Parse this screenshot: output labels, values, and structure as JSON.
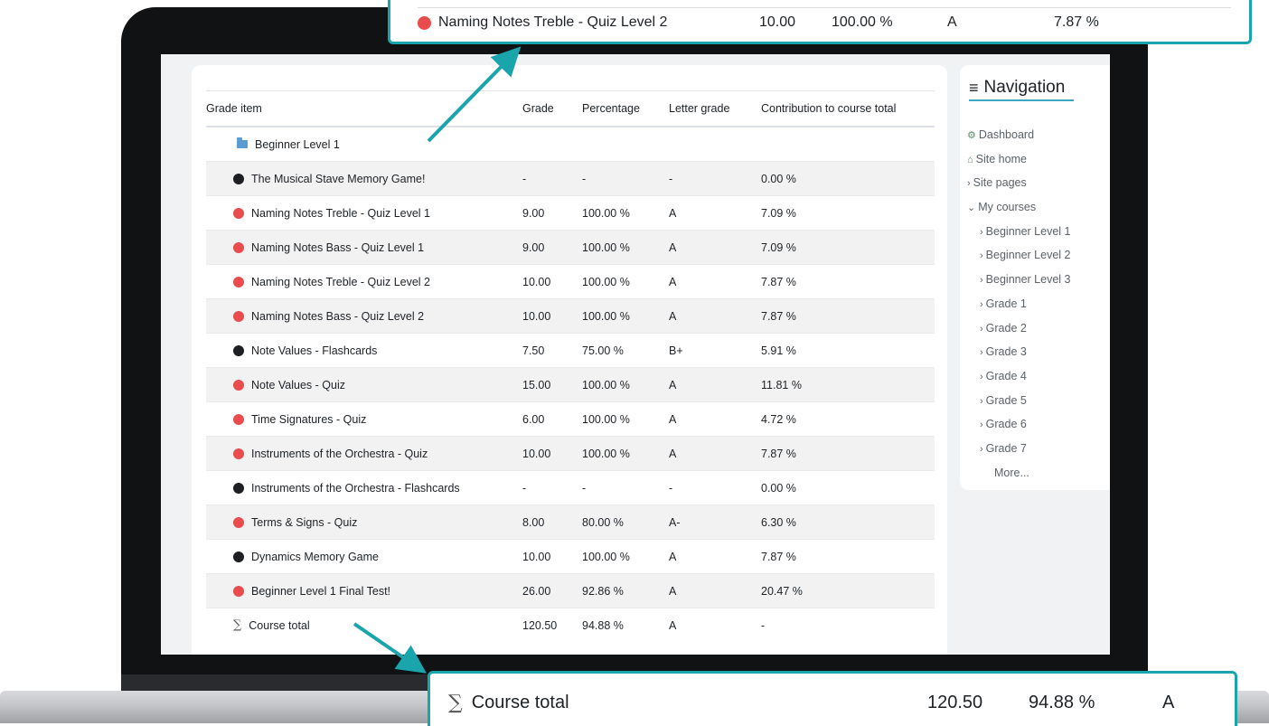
{
  "grade_table": {
    "headers": [
      "Grade item",
      "Grade",
      "Percentage",
      "Letter grade",
      "Contribution to course total"
    ],
    "category": "Beginner Level 1",
    "rows": [
      {
        "icon": "black",
        "name": "The Musical Stave Memory Game!",
        "grade": "-",
        "percentage": "-",
        "letter": "-",
        "contribution": "0.00 %"
      },
      {
        "icon": "red",
        "name": "Naming Notes Treble - Quiz Level 1",
        "grade": "9.00",
        "percentage": "100.00 %",
        "letter": "A",
        "contribution": "7.09 %"
      },
      {
        "icon": "red",
        "name": "Naming Notes Bass - Quiz Level 1",
        "grade": "9.00",
        "percentage": "100.00 %",
        "letter": "A",
        "contribution": "7.09 %"
      },
      {
        "icon": "red",
        "name": "Naming Notes Treble - Quiz Level 2",
        "grade": "10.00",
        "percentage": "100.00 %",
        "letter": "A",
        "contribution": "7.87 %"
      },
      {
        "icon": "red",
        "name": "Naming Notes Bass - Quiz Level 2",
        "grade": "10.00",
        "percentage": "100.00 %",
        "letter": "A",
        "contribution": "7.87 %"
      },
      {
        "icon": "black",
        "name": "Note Values - Flashcards",
        "grade": "7.50",
        "percentage": "75.00 %",
        "letter": "B+",
        "contribution": "5.91 %"
      },
      {
        "icon": "red",
        "name": "Note Values - Quiz",
        "grade": "15.00",
        "percentage": "100.00 %",
        "letter": "A",
        "contribution": "11.81 %"
      },
      {
        "icon": "red",
        "name": "Time Signatures - Quiz",
        "grade": "6.00",
        "percentage": "100.00 %",
        "letter": "A",
        "contribution": "4.72 %"
      },
      {
        "icon": "red",
        "name": "Instruments of the Orchestra - Quiz",
        "grade": "10.00",
        "percentage": "100.00 %",
        "letter": "A",
        "contribution": "7.87 %"
      },
      {
        "icon": "black",
        "name": "Instruments of the Orchestra - Flashcards",
        "grade": "-",
        "percentage": "-",
        "letter": "-",
        "contribution": "0.00 %"
      },
      {
        "icon": "red",
        "name": "Terms & Signs - Quiz",
        "grade": "8.00",
        "percentage": "80.00 %",
        "letter": "A-",
        "contribution": "6.30 %"
      },
      {
        "icon": "black",
        "name": "Dynamics Memory Game",
        "grade": "10.00",
        "percentage": "100.00 %",
        "letter": "A",
        "contribution": "7.87 %"
      },
      {
        "icon": "red",
        "name": "Beginner Level 1 Final Test!",
        "grade": "26.00",
        "percentage": "92.86 %",
        "letter": "A",
        "contribution": "20.47 %"
      }
    ],
    "total": {
      "name": "Course total",
      "grade": "120.50",
      "percentage": "94.88 %",
      "letter": "A",
      "contribution": "-"
    }
  },
  "navigation": {
    "title": "Navigation",
    "dashboard": "Dashboard",
    "site_home": "Site home",
    "site_pages": "Site pages",
    "my_courses": "My courses",
    "courses": [
      "Beginner Level 1",
      "Beginner Level 2",
      "Beginner Level 3",
      "Grade 1",
      "Grade 2",
      "Grade 3",
      "Grade 4",
      "Grade 5",
      "Grade 6",
      "Grade 7"
    ],
    "more": "More..."
  },
  "zoom_top": {
    "name": "Naming Notes Treble - Quiz Level 2",
    "grade": "10.00",
    "percentage": "100.00 %",
    "letter": "A",
    "contribution": "7.87 %"
  },
  "zoom_bottom": {
    "name": "Course total",
    "grade": "120.50",
    "percentage": "94.88 %",
    "letter": "A"
  },
  "colors": {
    "accent": "#1aa5ac",
    "quiz_icon": "#e84c4c",
    "activity_icon": "#1d1f22",
    "folder": "#5b9dd3"
  }
}
